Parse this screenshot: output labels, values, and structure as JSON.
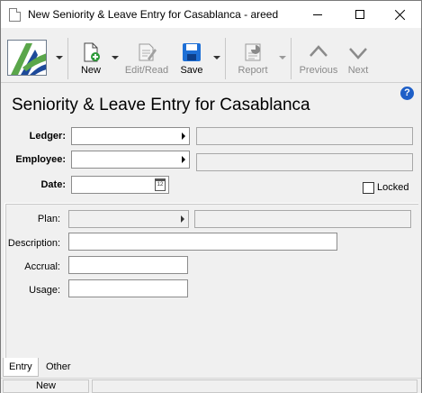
{
  "window": {
    "title": "New Seniority & Leave Entry for Casablanca - areed"
  },
  "toolbar": {
    "new_label": "New",
    "edit_label": "Edit/Read",
    "save_label": "Save",
    "report_label": "Report",
    "previous_label": "Previous",
    "next_label": "Next"
  },
  "form": {
    "heading": "Seniority & Leave Entry for Casablanca",
    "ledger_label": "Ledger:",
    "ledger_value": "",
    "ledger_description": "",
    "employee_label": "Employee:",
    "employee_value": "",
    "employee_description": "",
    "date_label": "Date:",
    "date_value": "",
    "locked_label": "Locked",
    "plan_label": "Plan:",
    "plan_value": "",
    "plan_description": "",
    "description_label": "Description:",
    "description_value": "",
    "accrual_label": "Accrual:",
    "accrual_value": "",
    "usage_label": "Usage:",
    "usage_value": ""
  },
  "tabs": [
    {
      "label": "Entry",
      "active": true
    },
    {
      "label": "Other",
      "active": false
    }
  ],
  "status": {
    "mode": "New"
  },
  "colors": {
    "logo_green": "#5aa64a",
    "logo_blue": "#1e4a9a",
    "save_blue": "#1d6fd6",
    "help_blue": "#1f5fc7"
  }
}
